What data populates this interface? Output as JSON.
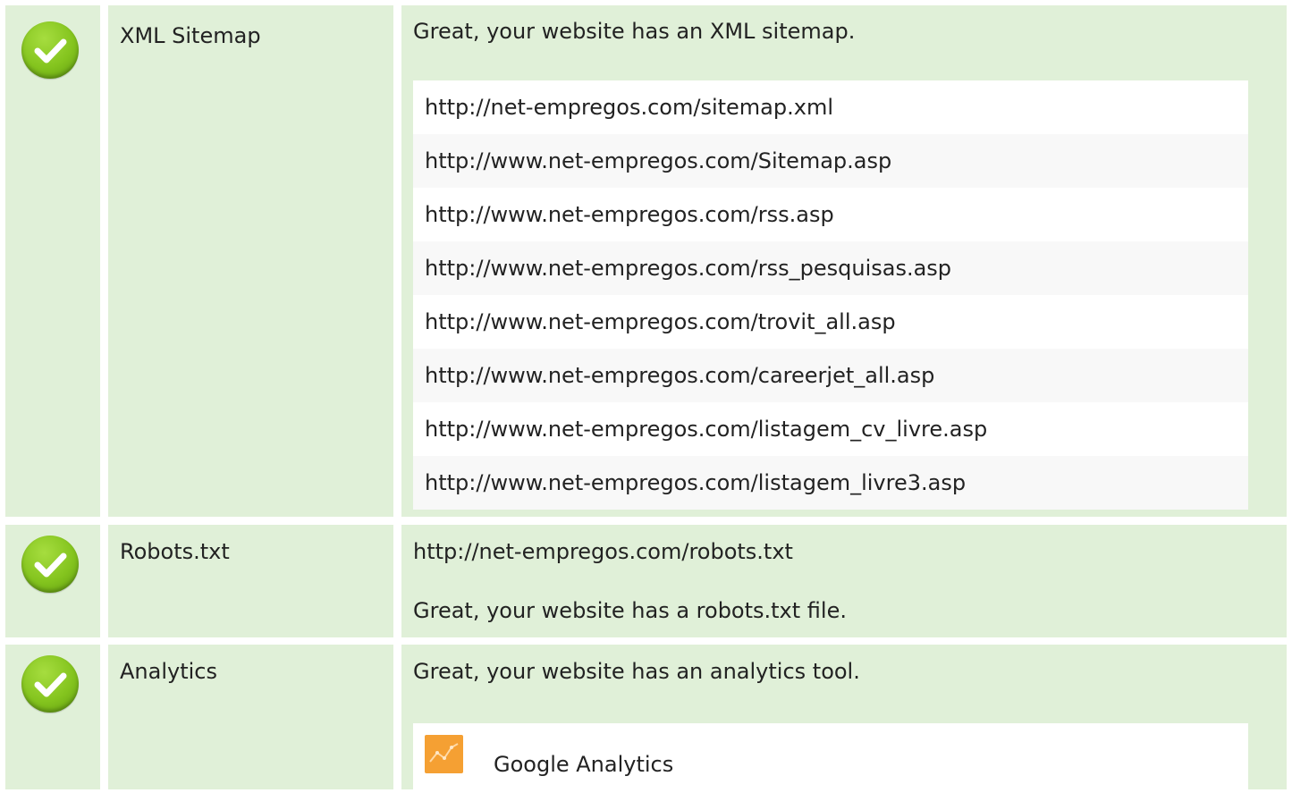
{
  "checks": {
    "xml_sitemap": {
      "label": "XML Sitemap",
      "message": "Great, your website has an XML sitemap.",
      "urls": [
        "http://net-empregos.com/sitemap.xml",
        "http://www.net-empregos.com/Sitemap.asp",
        "http://www.net-empregos.com/rss.asp",
        "http://www.net-empregos.com/rss_pesquisas.asp",
        "http://www.net-empregos.com/trovit_all.asp",
        "http://www.net-empregos.com/careerjet_all.asp",
        "http://www.net-empregos.com/listagem_cv_livre.asp",
        "http://www.net-empregos.com/listagem_livre3.asp"
      ]
    },
    "robots": {
      "label": "Robots.txt",
      "url": "http://net-empregos.com/robots.txt",
      "message": "Great, your website has a robots.txt file."
    },
    "analytics": {
      "label": "Analytics",
      "message": "Great, your website has an analytics tool.",
      "tool": {
        "name": "Google Analytics",
        "icon": "google-analytics-icon"
      }
    }
  },
  "icons": {
    "status": "checkmark-icon"
  },
  "colors": {
    "row_bg": "#e0f0d8",
    "check_green": "#84c41e",
    "analytics_orange": "#f5a033"
  }
}
